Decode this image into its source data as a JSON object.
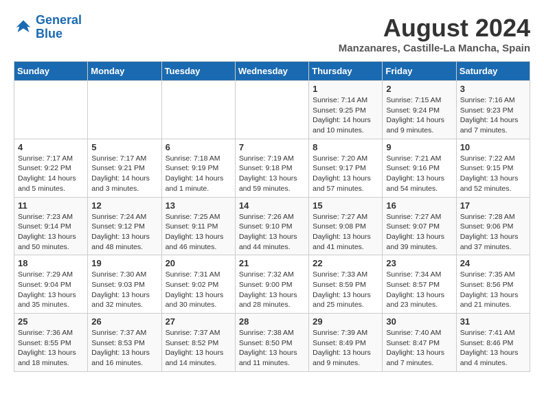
{
  "header": {
    "logo_line1": "General",
    "logo_line2": "Blue",
    "title": "August 2024",
    "location": "Manzanares, Castille-La Mancha, Spain"
  },
  "days_of_week": [
    "Sunday",
    "Monday",
    "Tuesday",
    "Wednesday",
    "Thursday",
    "Friday",
    "Saturday"
  ],
  "weeks": [
    [
      {
        "day": "",
        "info": ""
      },
      {
        "day": "",
        "info": ""
      },
      {
        "day": "",
        "info": ""
      },
      {
        "day": "",
        "info": ""
      },
      {
        "day": "1",
        "info": "Sunrise: 7:14 AM\nSunset: 9:25 PM\nDaylight: 14 hours\nand 10 minutes."
      },
      {
        "day": "2",
        "info": "Sunrise: 7:15 AM\nSunset: 9:24 PM\nDaylight: 14 hours\nand 9 minutes."
      },
      {
        "day": "3",
        "info": "Sunrise: 7:16 AM\nSunset: 9:23 PM\nDaylight: 14 hours\nand 7 minutes."
      }
    ],
    [
      {
        "day": "4",
        "info": "Sunrise: 7:17 AM\nSunset: 9:22 PM\nDaylight: 14 hours\nand 5 minutes."
      },
      {
        "day": "5",
        "info": "Sunrise: 7:17 AM\nSunset: 9:21 PM\nDaylight: 14 hours\nand 3 minutes."
      },
      {
        "day": "6",
        "info": "Sunrise: 7:18 AM\nSunset: 9:19 PM\nDaylight: 14 hours\nand 1 minute."
      },
      {
        "day": "7",
        "info": "Sunrise: 7:19 AM\nSunset: 9:18 PM\nDaylight: 13 hours\nand 59 minutes."
      },
      {
        "day": "8",
        "info": "Sunrise: 7:20 AM\nSunset: 9:17 PM\nDaylight: 13 hours\nand 57 minutes."
      },
      {
        "day": "9",
        "info": "Sunrise: 7:21 AM\nSunset: 9:16 PM\nDaylight: 13 hours\nand 54 minutes."
      },
      {
        "day": "10",
        "info": "Sunrise: 7:22 AM\nSunset: 9:15 PM\nDaylight: 13 hours\nand 52 minutes."
      }
    ],
    [
      {
        "day": "11",
        "info": "Sunrise: 7:23 AM\nSunset: 9:14 PM\nDaylight: 13 hours\nand 50 minutes."
      },
      {
        "day": "12",
        "info": "Sunrise: 7:24 AM\nSunset: 9:12 PM\nDaylight: 13 hours\nand 48 minutes."
      },
      {
        "day": "13",
        "info": "Sunrise: 7:25 AM\nSunset: 9:11 PM\nDaylight: 13 hours\nand 46 minutes."
      },
      {
        "day": "14",
        "info": "Sunrise: 7:26 AM\nSunset: 9:10 PM\nDaylight: 13 hours\nand 44 minutes."
      },
      {
        "day": "15",
        "info": "Sunrise: 7:27 AM\nSunset: 9:08 PM\nDaylight: 13 hours\nand 41 minutes."
      },
      {
        "day": "16",
        "info": "Sunrise: 7:27 AM\nSunset: 9:07 PM\nDaylight: 13 hours\nand 39 minutes."
      },
      {
        "day": "17",
        "info": "Sunrise: 7:28 AM\nSunset: 9:06 PM\nDaylight: 13 hours\nand 37 minutes."
      }
    ],
    [
      {
        "day": "18",
        "info": "Sunrise: 7:29 AM\nSunset: 9:04 PM\nDaylight: 13 hours\nand 35 minutes."
      },
      {
        "day": "19",
        "info": "Sunrise: 7:30 AM\nSunset: 9:03 PM\nDaylight: 13 hours\nand 32 minutes."
      },
      {
        "day": "20",
        "info": "Sunrise: 7:31 AM\nSunset: 9:02 PM\nDaylight: 13 hours\nand 30 minutes."
      },
      {
        "day": "21",
        "info": "Sunrise: 7:32 AM\nSunset: 9:00 PM\nDaylight: 13 hours\nand 28 minutes."
      },
      {
        "day": "22",
        "info": "Sunrise: 7:33 AM\nSunset: 8:59 PM\nDaylight: 13 hours\nand 25 minutes."
      },
      {
        "day": "23",
        "info": "Sunrise: 7:34 AM\nSunset: 8:57 PM\nDaylight: 13 hours\nand 23 minutes."
      },
      {
        "day": "24",
        "info": "Sunrise: 7:35 AM\nSunset: 8:56 PM\nDaylight: 13 hours\nand 21 minutes."
      }
    ],
    [
      {
        "day": "25",
        "info": "Sunrise: 7:36 AM\nSunset: 8:55 PM\nDaylight: 13 hours\nand 18 minutes."
      },
      {
        "day": "26",
        "info": "Sunrise: 7:37 AM\nSunset: 8:53 PM\nDaylight: 13 hours\nand 16 minutes."
      },
      {
        "day": "27",
        "info": "Sunrise: 7:37 AM\nSunset: 8:52 PM\nDaylight: 13 hours\nand 14 minutes."
      },
      {
        "day": "28",
        "info": "Sunrise: 7:38 AM\nSunset: 8:50 PM\nDaylight: 13 hours\nand 11 minutes."
      },
      {
        "day": "29",
        "info": "Sunrise: 7:39 AM\nSunset: 8:49 PM\nDaylight: 13 hours\nand 9 minutes."
      },
      {
        "day": "30",
        "info": "Sunrise: 7:40 AM\nSunset: 8:47 PM\nDaylight: 13 hours\nand 7 minutes."
      },
      {
        "day": "31",
        "info": "Sunrise: 7:41 AM\nSunset: 8:46 PM\nDaylight: 13 hours\nand 4 minutes."
      }
    ]
  ]
}
